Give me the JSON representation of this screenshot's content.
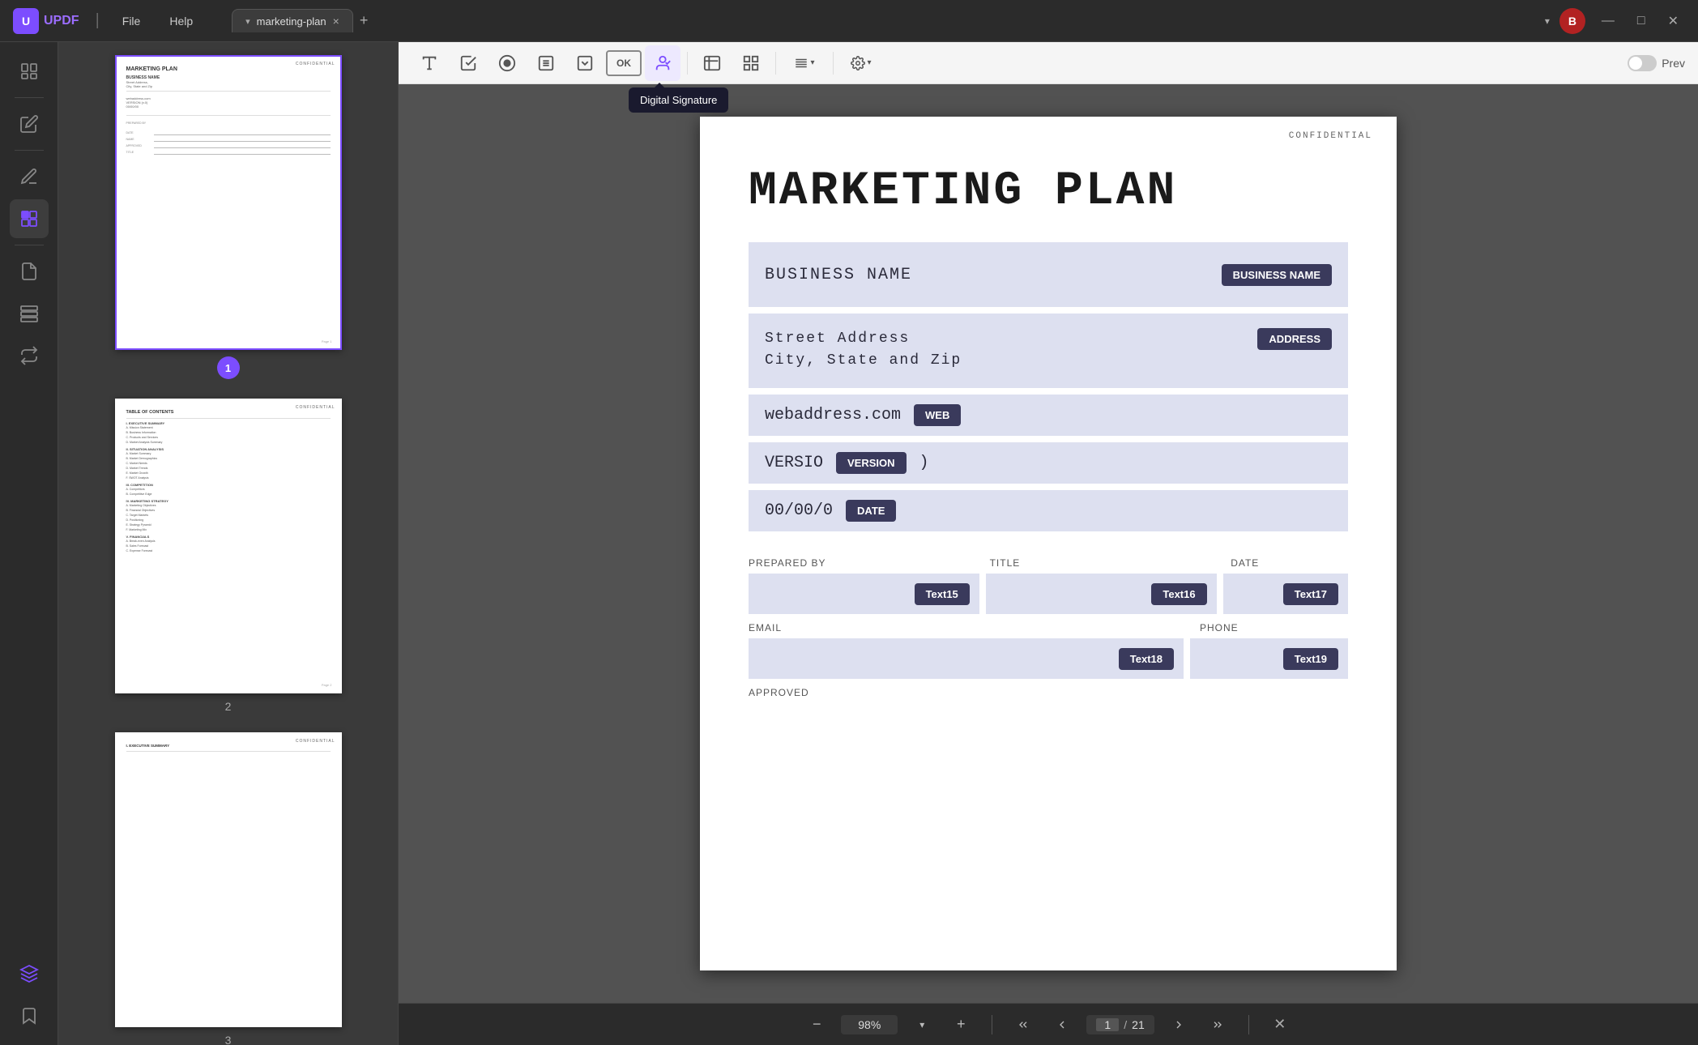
{
  "app": {
    "logo_text": "UPDF",
    "logo_letter": "U"
  },
  "titlebar": {
    "file_menu": "File",
    "help_menu": "Help",
    "tab_name": "marketing-plan",
    "tab_close": "×",
    "tab_add": "+",
    "user_initial": "B",
    "minimize": "—",
    "maximize": "□",
    "close": "✕"
  },
  "toolbar": {
    "tools": [
      {
        "name": "text-tool",
        "icon": "T",
        "label": "Text",
        "active": false
      },
      {
        "name": "checkbox-tool",
        "icon": "☑",
        "label": "Checkbox",
        "active": false
      },
      {
        "name": "radio-tool",
        "icon": "◉",
        "label": "Radio",
        "active": false
      },
      {
        "name": "list-tool",
        "icon": "☰",
        "label": "List",
        "active": false
      },
      {
        "name": "combo-tool",
        "icon": "▤",
        "label": "Combo",
        "active": false
      },
      {
        "name": "button-tool",
        "icon": "OK",
        "label": "Button",
        "active": false
      },
      {
        "name": "signature-tool",
        "icon": "✍",
        "label": "Signature",
        "active": true
      },
      {
        "name": "form-tool",
        "icon": "⊞",
        "label": "Form",
        "active": false
      },
      {
        "name": "align-tool",
        "icon": "≡",
        "label": "Align",
        "active": false
      },
      {
        "name": "settings-tool",
        "icon": "⚙",
        "label": "Settings",
        "active": false
      }
    ],
    "tooltip_text": "Digital Signature",
    "prev_label": "Prev",
    "toggle_label": "Toggle"
  },
  "thumbnails": [
    {
      "number": 1,
      "selected": true,
      "has_badge": true,
      "confidential": "CONFIDENTIAL",
      "title": "MARKETING PLAN",
      "sub1": "BUSINESS NAME",
      "sub2": "Street Address,",
      "sub3": "City, State and Zip",
      "page_label": "1"
    },
    {
      "number": 2,
      "selected": false,
      "has_badge": false,
      "confidential": "CONFIDENTIAL",
      "title": "TABLE OF CONTENTS",
      "page_label": "2"
    },
    {
      "number": 3,
      "selected": false,
      "has_badge": false,
      "confidential": "CONFIDENTIAL",
      "title": "I. EXECUTIVE SUMMARY",
      "page_label": "3"
    }
  ],
  "pdf": {
    "confidential": "CONFIDENTIAL",
    "main_title": "MARKETING PLAN",
    "business_name_text": "BUSINESS NAME",
    "business_name_badge": "BUSINESS NAME",
    "address_line1": "Street Address",
    "address_line2": "City, State and Zip",
    "address_badge": "ADDRESS",
    "web_text": "webaddress.com",
    "web_badge": "WEB",
    "version_text": "VERSION",
    "version_badge": "VERSION",
    "date_text": "00/00/0",
    "date_badge": "DATE",
    "prepared_by_label": "PREPARED BY",
    "title_label": "TITLE",
    "date_col_label": "DATE",
    "text15": "Text15",
    "text16": "Text16",
    "text17": "Text17",
    "email_label": "EMAIL",
    "phone_label": "PHONE",
    "text18": "Text18",
    "text19": "Text19",
    "approved_label": "APPROVED"
  },
  "bottom_toolbar": {
    "zoom_out": "−",
    "zoom_value": "98%",
    "zoom_dropdown": "▾",
    "zoom_in": "+",
    "go_first": "⋀",
    "go_prev_page": "∧",
    "current_page": "1",
    "page_sep": "/",
    "total_pages": "21",
    "go_next_page": "∨",
    "go_last": "⋁",
    "close_btn": "✕"
  }
}
